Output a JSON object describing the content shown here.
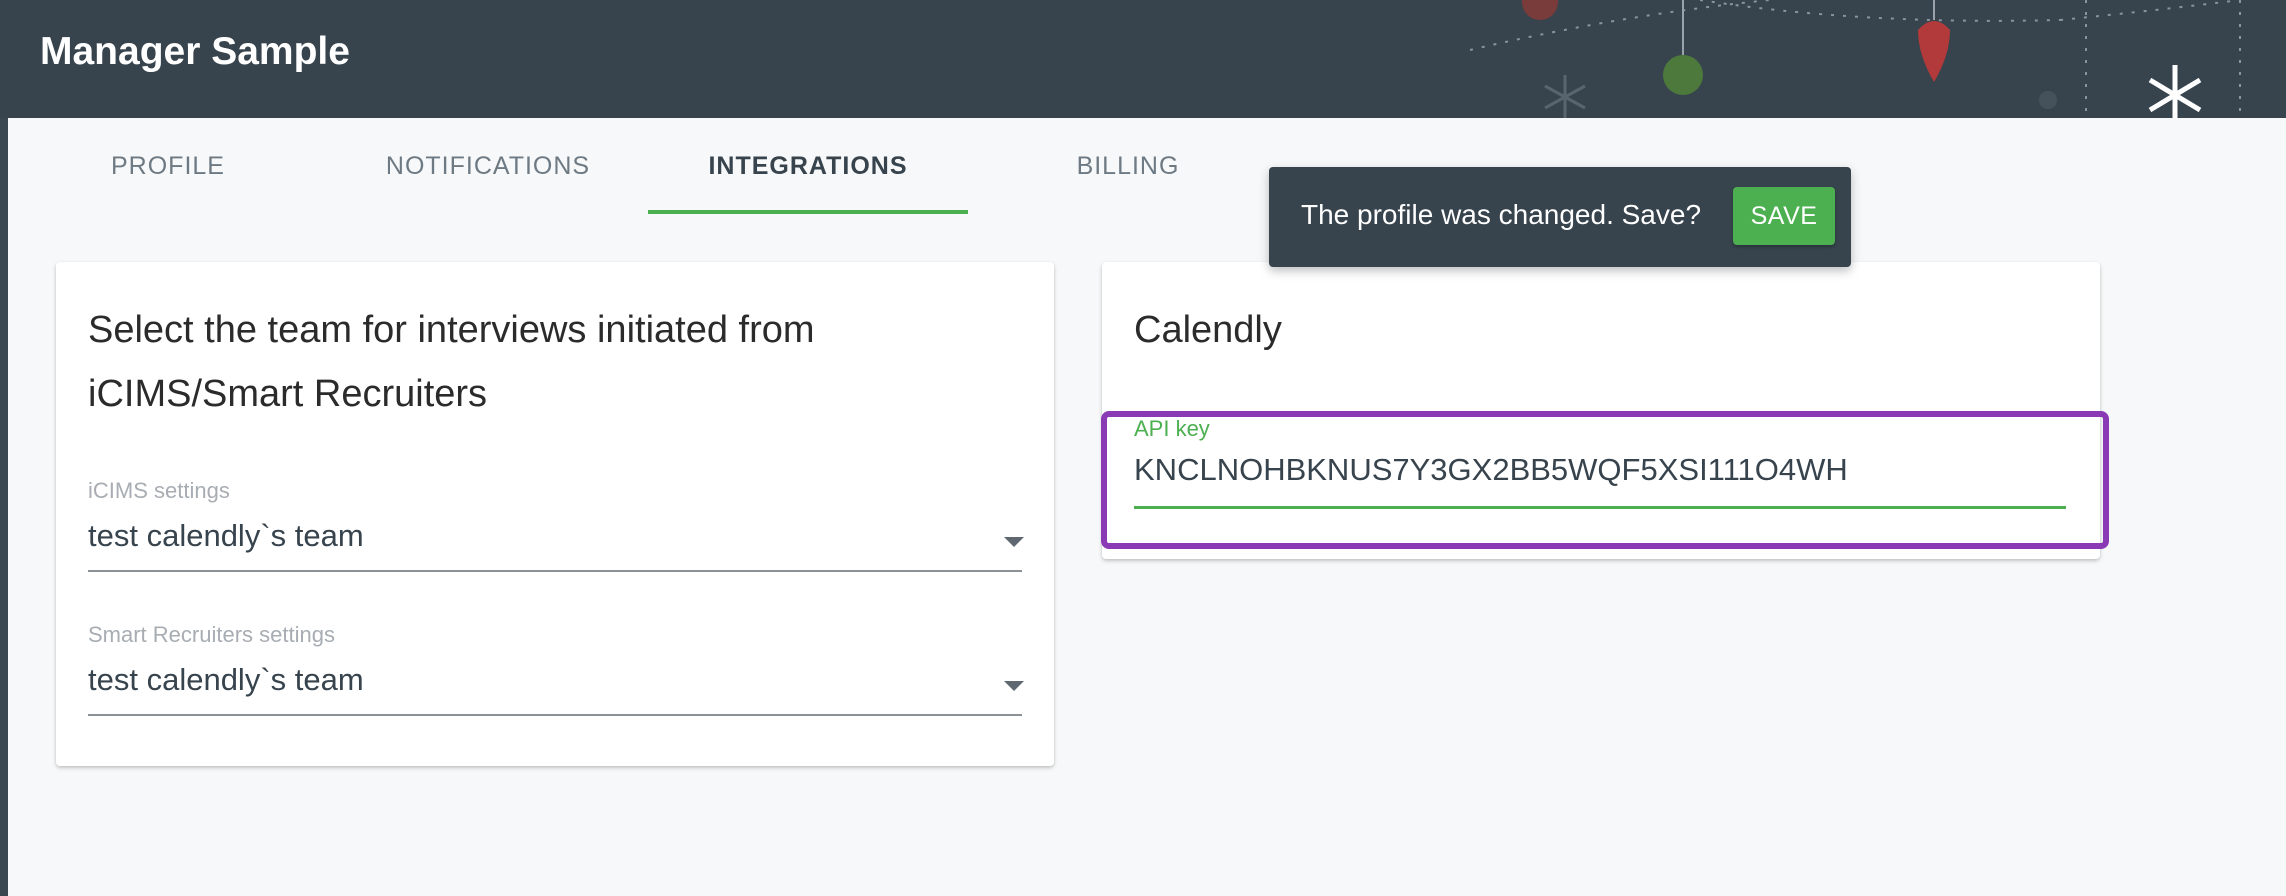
{
  "app": {
    "title": "Manager Sample"
  },
  "tabs": [
    {
      "label": "PROFILE"
    },
    {
      "label": "NOTIFICATIONS"
    },
    {
      "label": "INTEGRATIONS"
    },
    {
      "label": "BILLING"
    }
  ],
  "active_tab": "INTEGRATIONS",
  "team_card": {
    "title_line1": "Select the team for interviews initiated from",
    "title_line2": "iCIMS/Smart Recruiters",
    "icims": {
      "label": "iCIMS settings",
      "value": "test calendly`s team"
    },
    "smart": {
      "label": "Smart Recruiters settings",
      "value": "test calendly`s team"
    }
  },
  "calendly_card": {
    "title": "Calendly",
    "api_key_label": "API key",
    "api_key_value": "KNCLNOHBKNUS7Y3GX2BB5WQF5XSI111O4WH"
  },
  "snackbar": {
    "message": "The profile was changed. Save?",
    "button_label": "SAVE"
  },
  "colors": {
    "app_bar": "#37434d",
    "accent": "#4caf50",
    "highlight": "#8a3ab5"
  },
  "icons": [
    "ornament-icon",
    "snowflake-icon",
    "dropdown-caret-icon"
  ]
}
